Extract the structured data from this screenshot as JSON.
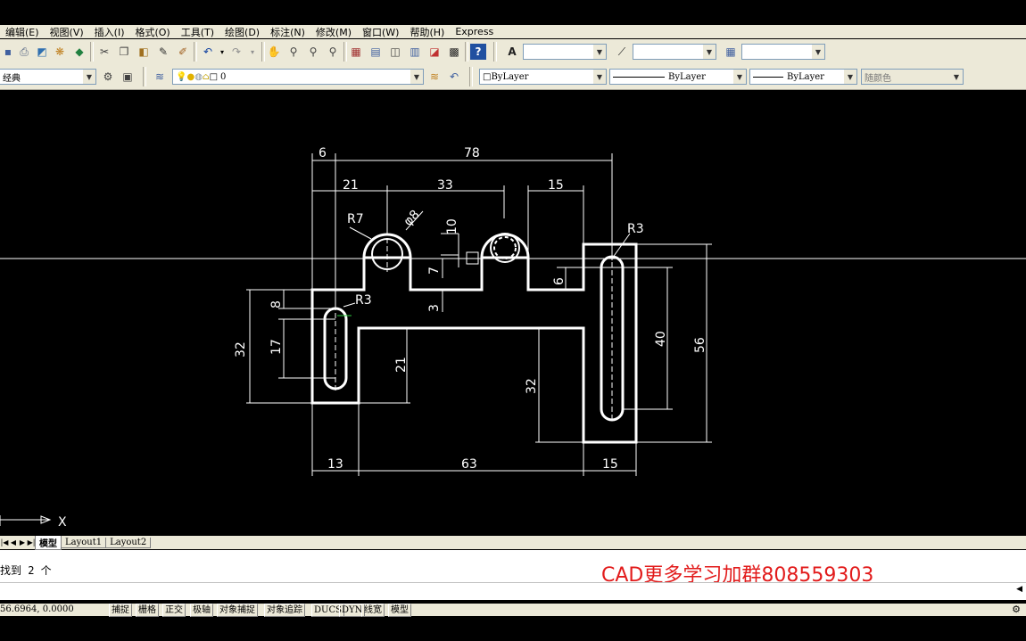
{
  "menu": [
    "编辑(E)",
    "视图(V)",
    "插入(I)",
    "格式(O)",
    "工具(T)",
    "绘图(D)",
    "标注(N)",
    "修改(M)",
    "窗口(W)",
    "帮助(H)",
    "Express"
  ],
  "toolbar2": {
    "workspace": "经典",
    "layer": "0",
    "color": "ByLayer",
    "linetype": "ByLayer",
    "lineweight": "ByLayer",
    "plotstyle": "随颜色"
  },
  "drawing": {
    "dims": {
      "d6_top": "6",
      "d78": "78",
      "d21": "21",
      "d33": "33",
      "d15_top": "15",
      "r7": "R7",
      "phi8": "φ8",
      "d10": "10",
      "r3_right": "R3",
      "d7": "7",
      "d6_mid": "6",
      "d3": "3",
      "d8": "8",
      "r3_left": "R3",
      "d32_left": "32",
      "d17": "17",
      "d21_inner": "21",
      "d32_mid": "32",
      "d40": "40",
      "d56": "56",
      "d13": "13",
      "d63": "63",
      "d15_bottom": "15"
    },
    "axis_x": "X"
  },
  "layout_tabs": [
    "模型",
    "Layout1",
    "Layout2"
  ],
  "command": {
    "line1": "找到 2 个",
    "watermark": "CAD更多学习加群808559303"
  },
  "status": {
    "coords": "56.6964, 0.0000",
    "toggles": [
      "捕捉",
      "栅格",
      "正交",
      "极轴",
      "对象捕捉",
      "对象追踪",
      "DUCS",
      "DYN",
      "线宽",
      "模型"
    ]
  }
}
